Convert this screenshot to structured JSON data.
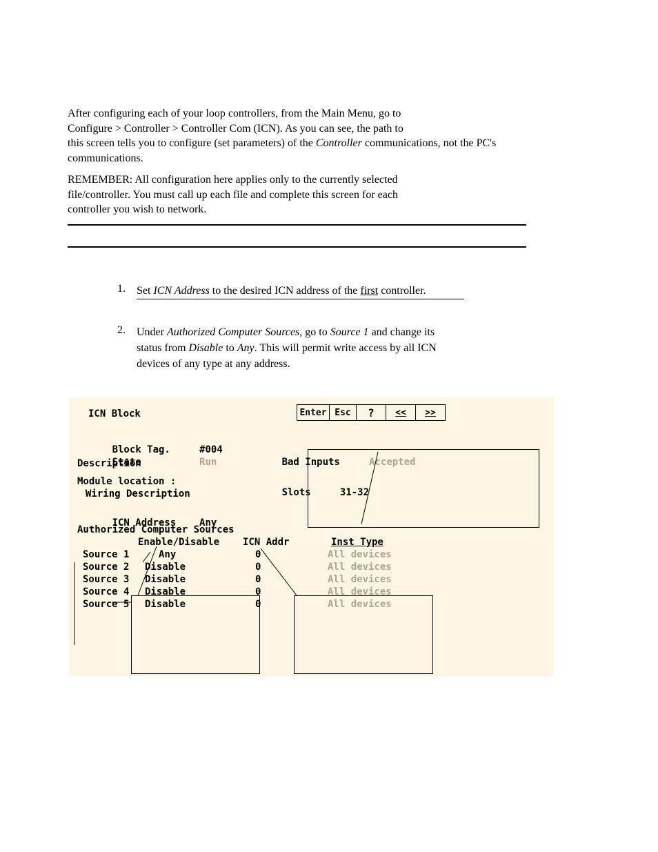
{
  "doc": {
    "line1": "After configuring each of your loop controllers, from the Main Menu, go to",
    "line2": "Configure > Controller > Controller Com (ICN).  As you can see, the path to",
    "line3_a": "this screen tells you to configure (set parameters) of the ",
    "line3_b": "Controller",
    "line3_c": " communications, not the PC's communications.",
    "line4": "REMEMBER: All configuration here applies only to the currently selected",
    "line5": "file/controller.  You must call up each file and complete this screen for each",
    "line6": "controller you wish to network.",
    "step1_num": "1.",
    "step1_a": "Set ",
    "step1_b": "ICN Address",
    "step1_c": " to the desired ICN address of the ",
    "step1_d": "first",
    "step1_e": " controller.",
    "step2_num": "2.",
    "step2_a": "Under ",
    "step2_b": "Authorized Computer Sources",
    "step2_c": ", go to ",
    "step2_d": "Source 1",
    "step2_e": " and change its",
    "step2_line2_a": "status from ",
    "step2_line2_b": "Disable",
    "step2_line2_c": " to ",
    "step2_line2_d": "Any",
    "step2_line2_e": ".  This will permit write access by all ICN",
    "step2_line3": "devices of any type at any address."
  },
  "panel": {
    "title": "ICN Block",
    "toolbar": {
      "enter": "Enter",
      "esc": "Esc",
      "help": "?",
      "prev": "<<",
      "next": ">>"
    },
    "fields": {
      "block_tag_label": "Block Tag.",
      "block_tag_value": "#004",
      "state_label": "State",
      "state_value": "Run",
      "bad_inputs_label": "Bad Inputs",
      "bad_inputs_value": "Accepted",
      "description_label": "Description",
      "module_loc_label": "Module location :",
      "slots_label": "Slots",
      "slots_value": "31-32",
      "wiring_label": "Wiring Description",
      "icn_addr_label": "ICN Address",
      "icn_addr_value": "Any",
      "auth_label": "Authorized Computer Sources",
      "col_enable": "Enable/Disable",
      "col_icnaddr": "ICN Addr",
      "col_insttype": "Inst Type"
    },
    "sources": [
      {
        "label": "Source 1",
        "enable": "Any",
        "icn": "0",
        "type": "All devices"
      },
      {
        "label": "Source 2",
        "enable": "Disable",
        "icn": "0",
        "type": "All devices"
      },
      {
        "label": "Source 3",
        "enable": "Disable",
        "icn": "0",
        "type": "All devices"
      },
      {
        "label": "Source 4",
        "enable": "Disable",
        "icn": "0",
        "type": "All devices"
      },
      {
        "label": "Source 5",
        "enable": "Disable",
        "icn": "0",
        "type": "All devices"
      }
    ]
  }
}
